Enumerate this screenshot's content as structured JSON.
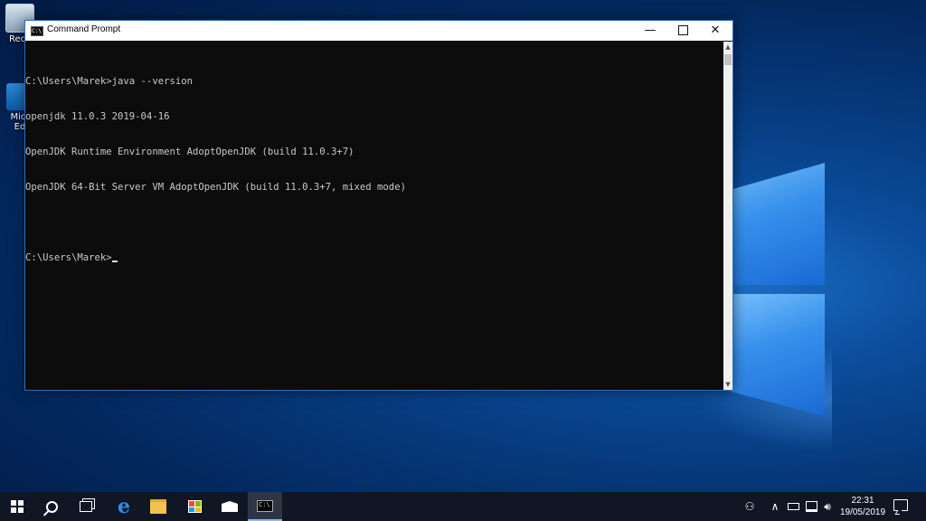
{
  "desktop": {
    "icons": [
      {
        "label": "Recy",
        "icon": "recycle-bin-icon"
      },
      {
        "label": "Micr\nEd",
        "icon": "edge-shortcut-icon"
      }
    ]
  },
  "window": {
    "title": "Command Prompt",
    "controls": {
      "minimize": "—",
      "maximize": "",
      "close": "✕"
    },
    "console_lines": [
      "C:\\Users\\Marek>java --version",
      "openjdk 11.0.3 2019-04-16",
      "OpenJDK Runtime Environment AdoptOpenJDK (build 11.0.3+7)",
      "OpenJDK 64-Bit Server VM AdoptOpenJDK (build 11.0.3+7, mixed mode)",
      "",
      "C:\\Users\\Marek>"
    ]
  },
  "taskbar": {
    "pinned": [
      {
        "name": "start",
        "icon": "windows-start-icon"
      },
      {
        "name": "search",
        "icon": "search-icon"
      },
      {
        "name": "task-view",
        "icon": "task-view-icon"
      },
      {
        "name": "edge",
        "icon": "edge-browser-icon"
      },
      {
        "name": "file-explorer",
        "icon": "folder-icon"
      },
      {
        "name": "store",
        "icon": "store-icon"
      },
      {
        "name": "mail",
        "icon": "mail-icon"
      },
      {
        "name": "command-prompt",
        "icon": "command-prompt-icon",
        "active": true
      }
    ],
    "tray": {
      "people": "⚇",
      "chevron": "∧",
      "time": "22:31",
      "date": "19/05/2019"
    }
  },
  "colors": {
    "accent": "#2d6fb7",
    "taskbar": "#101623",
    "console_bg": "#0c0c0c",
    "console_text": "#c8c8c8"
  }
}
